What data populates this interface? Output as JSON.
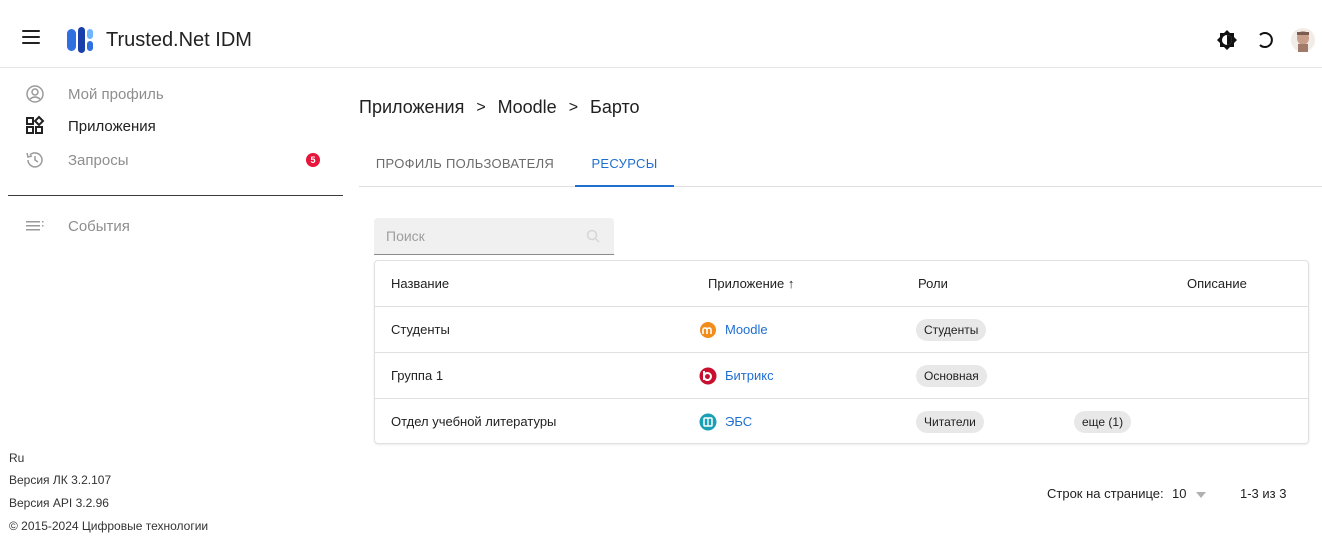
{
  "header": {
    "app_title": "Trusted.Net IDM",
    "icons": [
      "menu-icon",
      "logo-icon",
      "theme-toggle-icon",
      "refresh-icon",
      "user-avatar"
    ]
  },
  "sidebar": {
    "items": [
      {
        "label": "Мой профиль",
        "icon": "account-circle-icon"
      },
      {
        "label": "Приложения",
        "icon": "apps-icon"
      },
      {
        "label": "Запросы",
        "icon": "history-icon",
        "badge": "5"
      },
      {
        "label": "События",
        "icon": "list-icon"
      }
    ],
    "footer": {
      "language": "Ru",
      "version_lk": "Версия ЛК 3.2.107",
      "version_api": "Версия API 3.2.96",
      "copyright": "© 2015-2024 Цифровые технологии"
    }
  },
  "breadcrumb": [
    "Приложения",
    ">",
    "Moodle",
    ">",
    "Барто"
  ],
  "tabs": [
    {
      "label": "ПРОФИЛЬ ПОЛЬЗОВАТЕЛЯ",
      "active": false
    },
    {
      "label": "РЕСУРСЫ",
      "active": true
    }
  ],
  "search": {
    "placeholder": "Поиск",
    "value": ""
  },
  "table": {
    "columns": [
      "Название",
      "Приложение ↑",
      "Роли",
      "Описание"
    ],
    "rows": [
      {
        "name": "Студенты",
        "app": "Moodle",
        "app_icon": "moodle-icon",
        "roles": [
          "Студенты"
        ],
        "more": ""
      },
      {
        "name": "Группа 1",
        "app": "Битрикс",
        "app_icon": "bitrix-icon",
        "roles": [
          "Основная"
        ],
        "more": ""
      },
      {
        "name": "Отдел учебной литературы",
        "app": "ЭБС",
        "app_icon": "ebs-icon",
        "roles": [
          "Читатели"
        ],
        "more": "еще (1)"
      }
    ]
  },
  "pagination": {
    "rows_per_page_label": "Строк на странице:",
    "rows_per_page_value": "10",
    "range": "1-3 из 3"
  },
  "colors": {
    "accent": "#1f6fd1",
    "badge": "#e8163a",
    "chip": "#e8e8e8"
  }
}
